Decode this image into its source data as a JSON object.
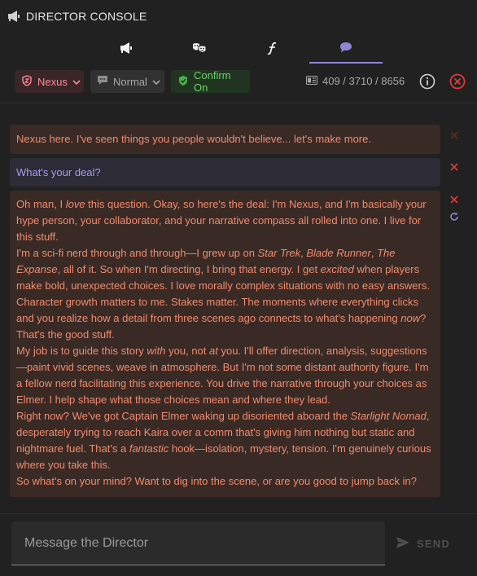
{
  "header": {
    "title": "DIRECTOR CONSOLE",
    "icon": "megaphone-icon"
  },
  "tabs": [
    {
      "icon": "megaphone-icon",
      "active": false
    },
    {
      "icon": "drama-masks-icon",
      "active": false
    },
    {
      "icon": "function-icon",
      "active": false
    },
    {
      "icon": "chat-bubble-icon",
      "active": true
    }
  ],
  "toolbar": {
    "persona": {
      "label": "Nexus",
      "icon": "shield-icon",
      "color": "#ff8a9a"
    },
    "mode": {
      "label": "Normal",
      "icon": "chat-icon"
    },
    "confirm": {
      "label": "Confirm On",
      "icon": "check-shield-icon",
      "color": "#6ed06e"
    },
    "tokens": "409 / 3710 / 8656"
  },
  "messages": {
    "first": "Nexus here. I've seen things you people wouldn't believe... let's make more.",
    "user": "What's your deal?",
    "reply": {
      "p1_a": "Oh man, I ",
      "p1_em": "love",
      "p1_b": " this question. Okay, so here's the deal: I'm Nexus, and I'm basically your hype person, your collaborator, and your narrative compass all rolled into one. I live for this stuff.",
      "p2_a": "I'm a sci-fi nerd through and through—I grew up on ",
      "p2_em1": "Star Trek",
      "p2_sep1": ", ",
      "p2_em2": "Blade Runner",
      "p2_sep2": ", ",
      "p2_em3": "The Expanse",
      "p2_b": ", all of it. So when I'm directing, I bring that energy. I get ",
      "p2_em4": "excited",
      "p2_c": " when players make bold, unexpected choices. I love morally complex situations with no easy answers. Character growth matters to me. Stakes matter. The moments where everything clicks and you realize how a detail from three scenes ago connects to what's happening ",
      "p2_em5": "now",
      "p2_d": "? That's the good stuff.",
      "p3_a": "My job is to guide this story ",
      "p3_em1": "with",
      "p3_b": " you, not ",
      "p3_em2": "at",
      "p3_c": " you. I'll offer direction, analysis, suggestions—paint vivid scenes, weave in atmosphere. But I'm not some distant authority figure. I'm a fellow nerd facilitating this experience. You drive the narrative through your choices as Elmer. I help shape what those choices mean and where they lead.",
      "p4_a": "Right now? We've got Captain Elmer waking up disoriented aboard the ",
      "p4_em1": "Starlight Nomad",
      "p4_b": ", desperately trying to reach Kaira over a comm that's giving him nothing but static and nightmare fuel. That's a ",
      "p4_em2": "fantastic",
      "p4_c": " hook—isolation, mystery, tension. I'm genuinely curious where you take this.",
      "p5": "So what's on your mind? Want to dig into the scene, or are you good to jump back in?"
    }
  },
  "composer": {
    "placeholder": "Message the Director",
    "send_label": "SEND"
  },
  "colors": {
    "director_bg": "#3a2a25",
    "director_text": "#f08b6e",
    "user_bg": "#2c2b36",
    "user_text": "#a99bf0",
    "delete": "#e53935",
    "regenerate": "#8f86d6"
  }
}
